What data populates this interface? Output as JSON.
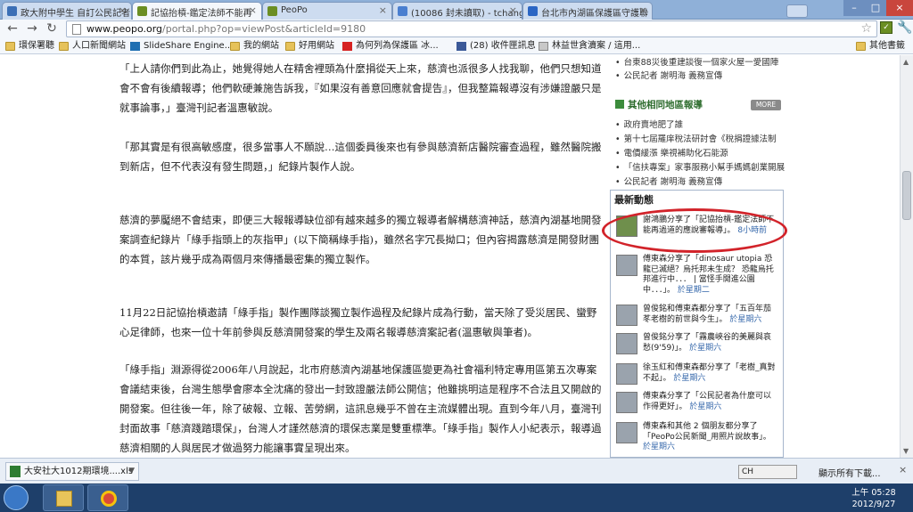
{
  "browser": {
    "tabs": [
      {
        "label": "政大附中學生 自訂公民記者",
        "favicon_color": "#3b6fb6",
        "active": false
      },
      {
        "label": "記協抬槓-鑑定法師不能再",
        "favicon_color": "#6b8e23",
        "active": true
      },
      {
        "label": "PeoPo",
        "favicon_color": "#6b8e23",
        "active": false
      },
      {
        "label": "(10086 封未讀取) - tchang",
        "favicon_color": "#4a7fd0",
        "active": false
      },
      {
        "label": "台北市內湖區保護區守護聯",
        "favicon_color": "#2b66c4",
        "active": false
      }
    ],
    "url_host": "www.peopo.org",
    "url_path": "/portal.php?op=viewPost&articleId=9180",
    "bookmarks": [
      {
        "label": "環保署聽",
        "icon": "folder-icon"
      },
      {
        "label": "人口新聞網站",
        "icon": "folder-icon"
      },
      {
        "label": "SlideShare Engine...",
        "icon": "slideshare-icon"
      },
      {
        "label": "我的網站",
        "icon": "folder-icon"
      },
      {
        "label": "好用網站",
        "icon": "folder-icon"
      },
      {
        "label": "為何列為保護區 冰...",
        "icon": "youtube-icon"
      },
      {
        "label": "(28) 收件匣訊息",
        "icon": "facebook-icon"
      },
      {
        "label": "林益世貪瀆案 / 這用...",
        "icon": "page-icon"
      }
    ],
    "other_bookmarks": "其他書籤"
  },
  "article": {
    "paragraphs": [
      "「上人請你們到此為止，她覺得她人在精舍裡頭為什麼捐從天上來，慈濟也派很多人找我聊，他們只想知道會不會有後續報導；他們軟硬兼施告訴我，『如果沒有善意回應就會提告』，但我整篇報導沒有涉嫌證嚴只是就事論事，」臺灣刊記者溫惠敏說。",
      "「那其實是有很高敏感度，很多當事人不願說…這個委員後來也有參與慈濟新店醫院審查過程，雖然醫院搬到新店，但不代表沒有發生問題，」紀錄片製作人說。",
      "慈濟的夢魘絕不會結束，即便三大報報導缺位卻有越來越多的獨立報導者解構慈濟神話，慈濟內湖基地開發案調查紀錄片「綠手指頭上的灰指甲」(以下簡稱綠手指)，雖然名字冗長拗口；但內容揭露慈濟是開發財團的本質，該片幾乎成為兩個月來傳播最密集的獨立製作。",
      "11月22日記協抬槓邀請「綠手指」製作團隊談獨立製作過程及紀錄片成為行動，當天除了受災居民、蠻野心足律師，也來一位十年前參與反慈濟開發案的學生及兩名報導慈濟案記者(溫惠敏與筆者)。",
      "「綠手指」淵源得從2006年八月說起，北市府慈濟內湖基地保護區變更為社會福利特定專用區第五次專案會議結束後，台灣生態學會廖本全沈痛的發出一封致證嚴法師公開信；他雖挑明這是程序不合法且又開啟的開發案。但往後一年，除了破報、立報、苦勞網，這訊息幾乎不曾在主流媒體出現。直到今年八月，臺灣刊封面故事「慈濟踐踏環保」，台灣人才謹然慈濟的環保志業是雙重標準。「綠手指」製作人小紀表示，報導過慈濟相關的人與居民才做過努力能讓事實呈現出來。"
    ]
  },
  "sidebar": {
    "top_items": [
      "台東88災後重建談復一個家火屋一愛國陣",
      "公民記者 謝明海 義務宣傳"
    ],
    "related_heading": "其他相同地區報導",
    "more_label": "MORE",
    "related_items": [
      "政府賣地肥了誰",
      "第十七屆羅庠稅法研討會《稅捐證據法制",
      "電價緩漲 樂視補助化石能源",
      "「信扶專案」家事服務小幫手媽媽創業開展",
      "公民記者 謝明海 義務宣傳"
    ],
    "activity_title": "最新動態",
    "activity": [
      {
        "text": "謝鴻鵬分享了「記協抬槓-鑑定法師不能再過道的應說審報導」。",
        "time": "8小時前"
      },
      {
        "text": "傅東森分享了「dinosaur utopia 恐龍已滅絕？烏托邦未生成？ 恐龍烏托邦進行中．．． | 當怪手開進公園中．．．」。",
        "time": "於星期二"
      },
      {
        "text": "曾俊銘和傅東森都分享了「五百年茄苳老樹的前世與今生」。",
        "time": "於星期六"
      },
      {
        "text": "曾俊銘分享了「霧農峽谷的美麗與哀愁(9'59)」。",
        "time": "於星期六"
      },
      {
        "text": "徐玉紅和傅東森都分享了「老樹_真對不起」。",
        "time": "於星期六"
      },
      {
        "text": "傅東森分享了「公民記者為什麼可以作得更好」。",
        "time": "於星期六"
      },
      {
        "text": "傅東森和其他 2 個朋友都分享了「PeoPo公民新聞_用照片說故事」。",
        "time": "於星期六"
      }
    ]
  },
  "downloads": {
    "file": "大安社大1012期環境....xls",
    "show_all": "顯示所有下載..."
  },
  "taskbar": {
    "ime": "CH",
    "time": "上午 05:28",
    "date": "2012/9/27"
  },
  "colors": {
    "highlight": "#d2232a",
    "sidebar_heading": "#2c6b2c",
    "link": "#3366aa"
  }
}
